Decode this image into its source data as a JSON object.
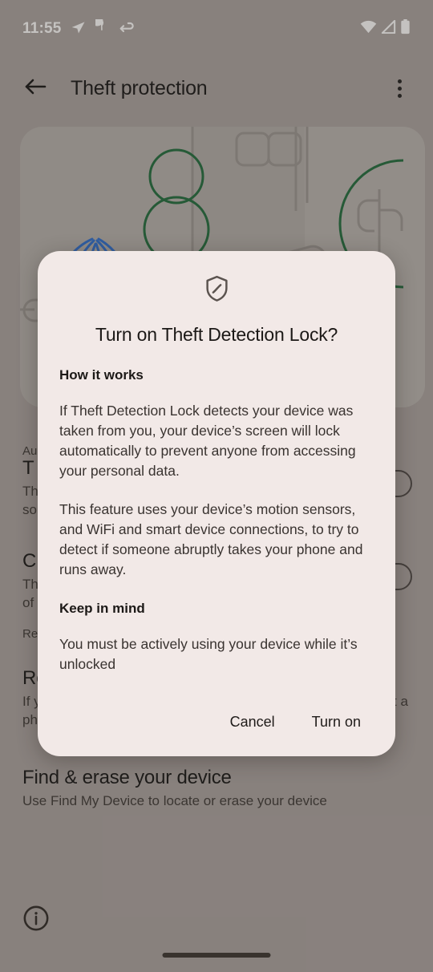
{
  "status_bar": {
    "time": "11:55",
    "left_icons": [
      "telegram-icon",
      "chat-bubble-icon",
      "arrow-icon"
    ],
    "right_icons": [
      "wifi-icon",
      "cellular-signal-icon",
      "battery-icon"
    ]
  },
  "app_bar": {
    "back_icon": "back-arrow-icon",
    "title": "Theft protection",
    "overflow_icon": "more-options-icon"
  },
  "illustration": {
    "name": "theft-protection-illustration",
    "accent_blue": "#2c6fd1",
    "accent_green": "#1d6b3c",
    "line_gray": "#9a9591",
    "card_bg": "#b5b0ac"
  },
  "settings": {
    "rows": [
      {
        "caption": "Au"
      },
      {
        "title": "T",
        "sub_line1": "Th",
        "sub_line2": "so",
        "toggle": "off"
      },
      {
        "title": "C",
        "sub_line1": "Th",
        "sub_line2": "of",
        "toggle": "off"
      },
      {
        "caption": "Re"
      }
    ],
    "remote_lock": {
      "title": "Re",
      "sub": "If your device is lost or stolen, you can lock its screen with just a phone number"
    },
    "find_erase": {
      "title": "Find & erase your device",
      "sub": "Use Find My Device to locate or erase your device"
    },
    "info_icon": "info-icon"
  },
  "dialog": {
    "icon": "shield-slash-icon",
    "title": "Turn on Theft Detection Lock?",
    "section1_head": "How it works",
    "section1_par1": "If Theft Detection Lock detects your device was taken from you, your device’s screen will lock automatically to prevent anyone from accessing your personal data.",
    "section1_par2": "This feature uses your device’s motion sensors, and WiFi and smart device connections, to try to detect if someone abruptly takes your phone and runs away.",
    "section2_head": "Keep in mind",
    "section2_par1": "You must be actively using your device while it’s unlocked",
    "cancel_label": "Cancel",
    "confirm_label": "Turn on",
    "surface_color": "#f2e9e7",
    "text_color": "#1c1917"
  },
  "nav_bar": {
    "pill": "home-gesture-pill"
  }
}
